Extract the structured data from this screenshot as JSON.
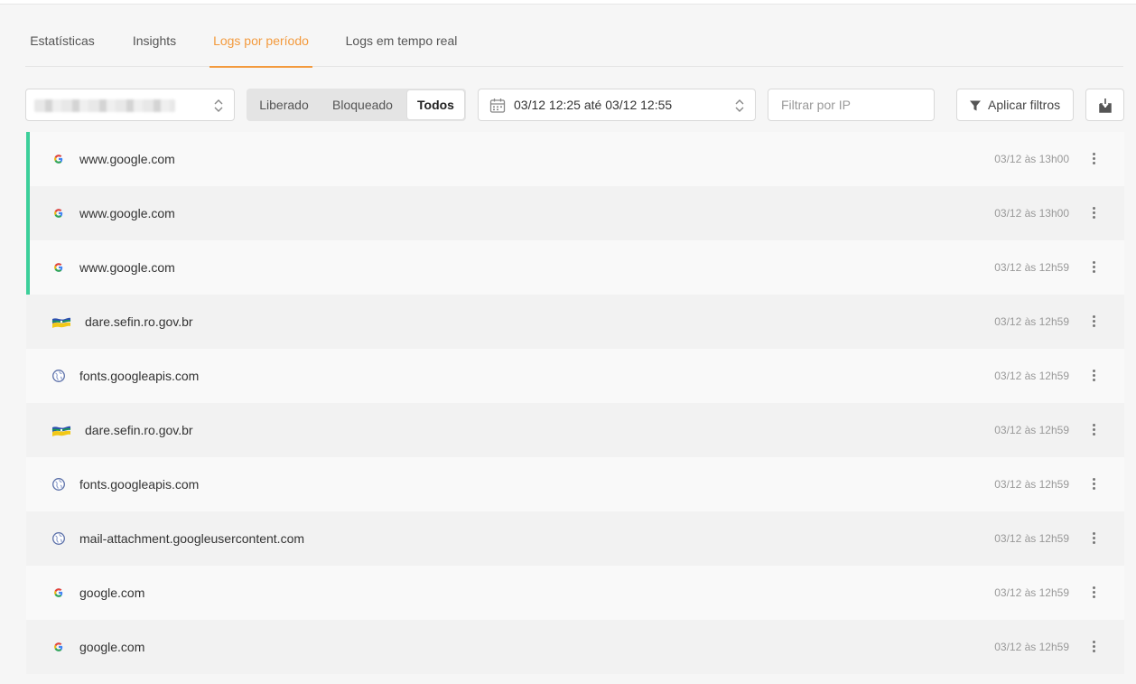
{
  "tabs": [
    {
      "label": "Estatísticas",
      "active": false
    },
    {
      "label": "Insights",
      "active": false
    },
    {
      "label": "Logs por período",
      "active": true
    },
    {
      "label": "Logs em tempo real",
      "active": false
    }
  ],
  "filters": {
    "status": {
      "options": [
        "Liberado",
        "Bloqueado",
        "Todos"
      ],
      "selected": "Todos"
    },
    "date_range": "03/12 12:25 até 03/12 12:55",
    "ip_placeholder": "Filtrar por IP",
    "apply_label": "Aplicar filtros"
  },
  "colors": {
    "accent": "#f39a3d",
    "allowed_marker": "#3ccf9a"
  },
  "logs": [
    {
      "domain": "www.google.com",
      "time": "03/12 às 13h00",
      "icon": "google-icon",
      "marked": true
    },
    {
      "domain": "www.google.com",
      "time": "03/12 às 13h00",
      "icon": "google-icon",
      "marked": true
    },
    {
      "domain": "www.google.com",
      "time": "03/12 às 12h59",
      "icon": "google-icon",
      "marked": true
    },
    {
      "domain": "dare.sefin.ro.gov.br",
      "time": "03/12 às 12h59",
      "icon": "state-flag-icon",
      "marked": false
    },
    {
      "domain": "fonts.googleapis.com",
      "time": "03/12 às 12h59",
      "icon": "globe-icon",
      "marked": false
    },
    {
      "domain": "dare.sefin.ro.gov.br",
      "time": "03/12 às 12h59",
      "icon": "state-flag-icon",
      "marked": false
    },
    {
      "domain": "fonts.googleapis.com",
      "time": "03/12 às 12h59",
      "icon": "globe-icon",
      "marked": false
    },
    {
      "domain": "mail-attachment.googleusercontent.com",
      "time": "03/12 às 12h59",
      "icon": "globe-icon",
      "marked": false
    },
    {
      "domain": "google.com",
      "time": "03/12 às 12h59",
      "icon": "google-icon",
      "marked": false
    },
    {
      "domain": "google.com",
      "time": "03/12 às 12h59",
      "icon": "google-icon",
      "marked": false
    }
  ]
}
